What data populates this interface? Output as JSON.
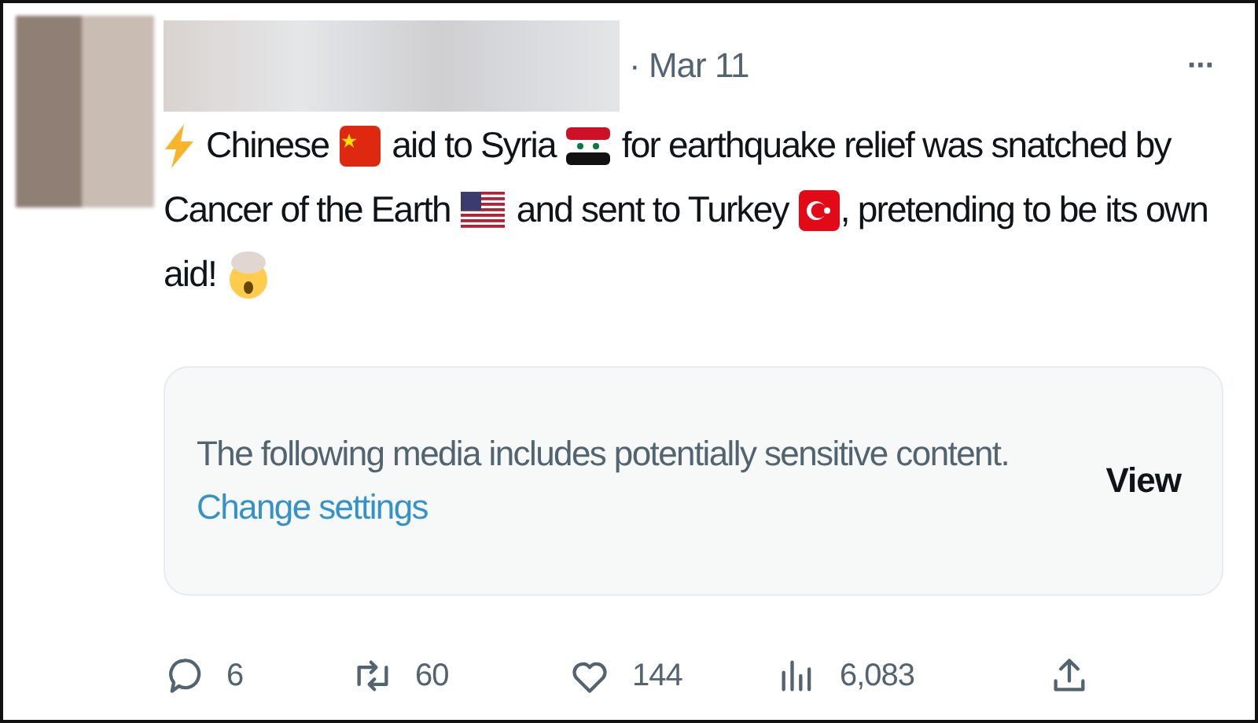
{
  "tweet": {
    "date": "· Mar 11",
    "more": "···",
    "lines": [
      [
        {
          "kind": "bolt"
        },
        {
          "kind": "text",
          "text": "Chinese"
        },
        {
          "kind": "flag-cn"
        },
        {
          "kind": "text",
          "text": "aid to Syria"
        },
        {
          "kind": "flag-sy"
        },
        {
          "kind": "text",
          "text": "for earthquake relief was snatched by"
        }
      ],
      [
        {
          "kind": "text",
          "text": "Cancer of the Earth"
        },
        {
          "kind": "flag-us"
        },
        {
          "kind": "text",
          "text": "and sent to Turkey"
        },
        {
          "kind": "flag-tr"
        },
        {
          "kind": "joined-text",
          "text": ", pretending to be its own"
        }
      ],
      [
        {
          "kind": "text",
          "text": "aid!"
        },
        {
          "kind": "mind-blown"
        }
      ]
    ],
    "media_notice": {
      "message": "The following media includes potentially sensitive content.",
      "link": "Change settings",
      "button": "View"
    },
    "actions": [
      {
        "kind": "reply",
        "count": "6"
      },
      {
        "kind": "repost",
        "count": "60"
      },
      {
        "kind": "like",
        "count": "144"
      },
      {
        "kind": "views",
        "count": "6,083"
      },
      {
        "kind": "share"
      }
    ]
  }
}
